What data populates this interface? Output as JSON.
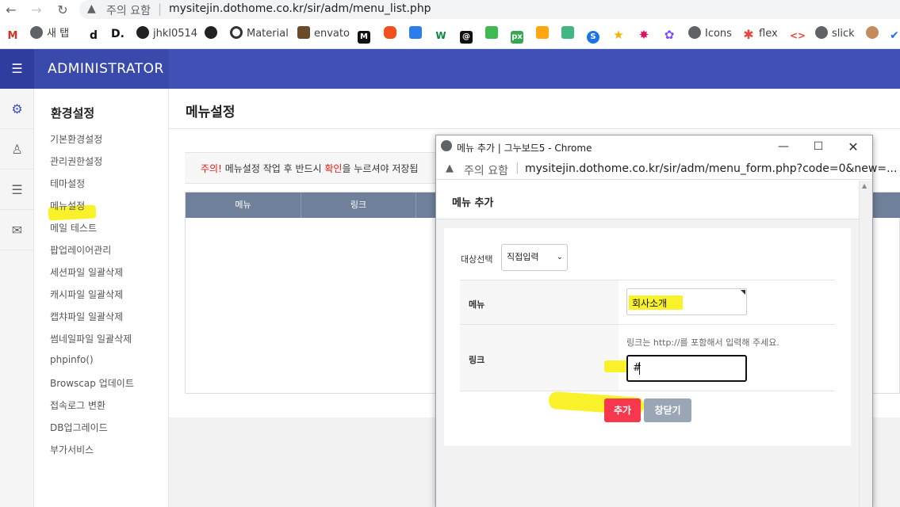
{
  "browser": {
    "security_label": "주의 요함",
    "url": "mysitejin.dothome.co.kr/sir/adm/menu_list.php",
    "bookmarks": [
      {
        "label": "새 탭",
        "icon": "globe-icon"
      },
      {
        "label": "",
        "icon": "bookmark-d-icon"
      },
      {
        "label": "D.",
        "icon": "bookmark-d-icon"
      },
      {
        "label": "jhkl0514",
        "icon": "github-icon"
      },
      {
        "label": "",
        "icon": "github-icon"
      },
      {
        "label": "Material",
        "icon": "material-icon"
      },
      {
        "label": "envato",
        "icon": "envato-icon"
      },
      {
        "label": "Icons",
        "icon": "globe-icon"
      },
      {
        "label": "flex",
        "icon": "asterisk-icon"
      },
      {
        "label": "slick",
        "icon": "globe-icon"
      }
    ]
  },
  "admin": {
    "brand": "ADMINISTRATOR"
  },
  "submenu": {
    "title": "환경설정",
    "items": [
      "기본환경설정",
      "관리권한설정",
      "테마설정",
      "메뉴설정",
      "메일 테스트",
      "팝업레이어관리",
      "세션파일 일괄삭제",
      "캐시파일 일괄삭제",
      "캡챠파일 일괄삭제",
      "썸네일파일 일괄삭제",
      "phpinfo()",
      "Browscap 업데이트",
      "접속로그 변환",
      "DB업그레이드",
      "부가서비스"
    ]
  },
  "page": {
    "title": "메뉴설정",
    "notice_warning": "주의!",
    "notice_text_1": " 메뉴설정 작업 후 반드시 ",
    "notice_confirm": "확인",
    "notice_text_2": "을 누르셔야 저장됩",
    "table_headers": [
      "메뉴",
      "링크"
    ]
  },
  "popup": {
    "window_title": "메뉴 추가 | 그누보드5 - Chrome",
    "security_label": "주의 요함",
    "url": "mysitejin.dothome.co.kr/sir/adm/menu_form.php?code=0&new=...",
    "header_title": "메뉴 추가",
    "target_label": "대상선택",
    "target_selected": "직접입력",
    "menu_label": "메뉴",
    "menu_value": "회사소개",
    "link_label": "링크",
    "link_help": "링크는 http://를 포함해서 입력해 주세요.",
    "link_value": "#",
    "add_button": "추가",
    "close_button": "창닫기"
  },
  "colors": {
    "header": "#3f51b5",
    "table_header": "#6f809a",
    "add_button": "#f5384d",
    "close_button": "#9aa6b6",
    "highlight": "#f9f22a"
  }
}
